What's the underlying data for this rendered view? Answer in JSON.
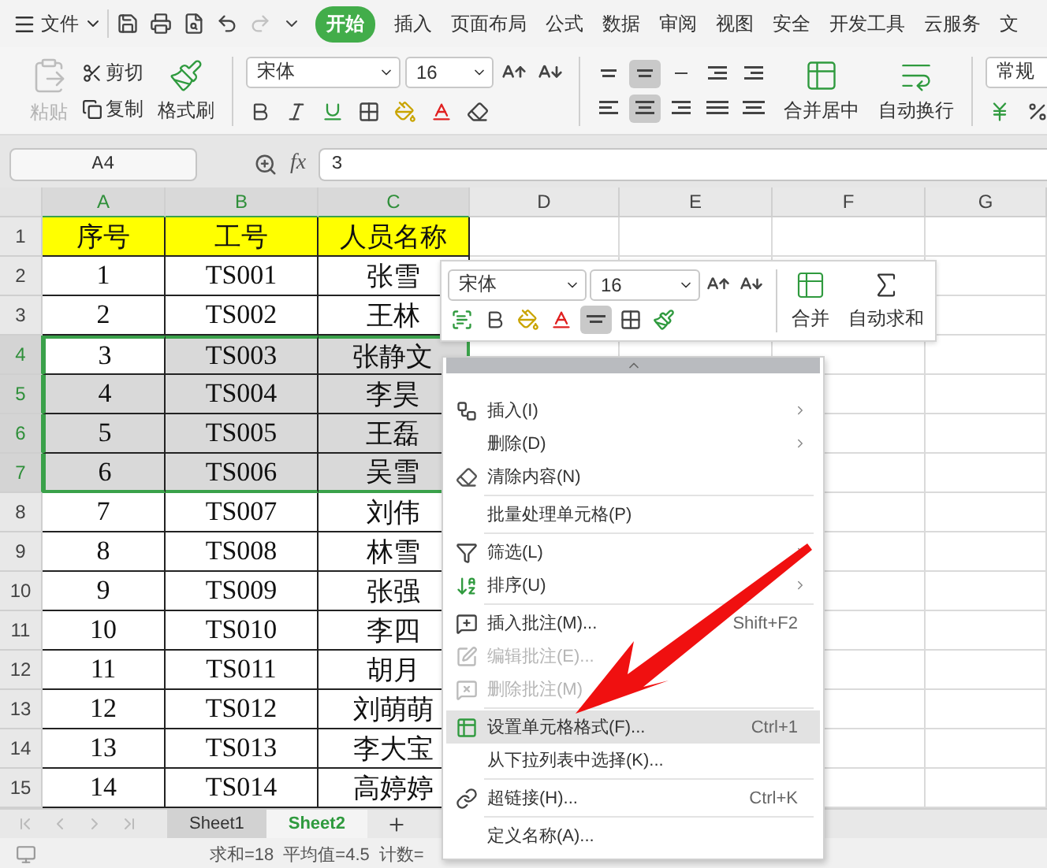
{
  "menu_bar": {
    "file_menu": "文件",
    "redo": {
      "disabled": true
    },
    "tabs": [
      {
        "label": "开始",
        "selected": true
      },
      {
        "label": "插入",
        "selected": false
      },
      {
        "label": "页面布局",
        "selected": false
      },
      {
        "label": "公式",
        "selected": false
      },
      {
        "label": "数据",
        "selected": false
      },
      {
        "label": "审阅",
        "selected": false
      },
      {
        "label": "视图",
        "selected": false
      },
      {
        "label": "安全",
        "selected": false
      },
      {
        "label": "开发工具",
        "selected": false
      },
      {
        "label": "云服务",
        "selected": false
      },
      {
        "label": "文",
        "selected": false
      }
    ]
  },
  "ribbon": {
    "paste": {
      "label": "粘贴",
      "disabled": true
    },
    "cut": "剪切",
    "copy": "复制",
    "format_painter": "格式刷",
    "font_name": "宋体",
    "font_size": "16",
    "vertical_align": [
      {
        "selected": false
      },
      {
        "selected": true
      },
      {
        "selected": false
      }
    ],
    "horizontal_align": [
      {
        "selected": false
      },
      {
        "selected": true
      },
      {
        "selected": false
      }
    ],
    "merge_center": "合并居中",
    "wrap_text": "自动换行",
    "number_format": "常规"
  },
  "formula_bar": {
    "name_box": "A4",
    "function_label": "fx",
    "value": "3"
  },
  "sheet": {
    "columns": [
      {
        "label": "A",
        "selected": true
      },
      {
        "label": "B",
        "selected": true
      },
      {
        "label": "C",
        "selected": true
      },
      {
        "label": "D",
        "selected": false
      },
      {
        "label": "E",
        "selected": false
      },
      {
        "label": "F",
        "selected": false
      },
      {
        "label": "G",
        "selected": false
      }
    ],
    "rows": [
      {
        "number": "1",
        "kind": "header",
        "selected": false,
        "active": false,
        "cells": [
          "序号",
          "工号",
          "人员名称"
        ]
      },
      {
        "number": "2",
        "kind": "data",
        "selected": false,
        "active": false,
        "cells": [
          "1",
          "TS001",
          "张雪"
        ]
      },
      {
        "number": "3",
        "kind": "data",
        "selected": false,
        "active": false,
        "cells": [
          "2",
          "TS002",
          "王林"
        ]
      },
      {
        "number": "4",
        "kind": "data",
        "selected": true,
        "active": true,
        "cells": [
          "3",
          "TS003",
          "张静文"
        ]
      },
      {
        "number": "5",
        "kind": "data",
        "selected": true,
        "active": false,
        "cells": [
          "4",
          "TS004",
          "李昊"
        ]
      },
      {
        "number": "6",
        "kind": "data",
        "selected": true,
        "active": false,
        "cells": [
          "5",
          "TS005",
          "王磊"
        ]
      },
      {
        "number": "7",
        "kind": "data",
        "selected": true,
        "active": false,
        "cells": [
          "6",
          "TS006",
          "吴雪"
        ]
      },
      {
        "number": "8",
        "kind": "data",
        "selected": false,
        "active": false,
        "cells": [
          "7",
          "TS007",
          "刘伟"
        ]
      },
      {
        "number": "9",
        "kind": "data",
        "selected": false,
        "active": false,
        "cells": [
          "8",
          "TS008",
          "林雪"
        ]
      },
      {
        "number": "10",
        "kind": "data",
        "selected": false,
        "active": false,
        "cells": [
          "9",
          "TS009",
          "张强"
        ]
      },
      {
        "number": "11",
        "kind": "data",
        "selected": false,
        "active": false,
        "cells": [
          "10",
          "TS010",
          "李四"
        ]
      },
      {
        "number": "12",
        "kind": "data",
        "selected": false,
        "active": false,
        "cells": [
          "11",
          "TS011",
          "胡月"
        ]
      },
      {
        "number": "13",
        "kind": "data",
        "selected": false,
        "active": false,
        "cells": [
          "12",
          "TS012",
          "刘萌萌"
        ]
      },
      {
        "number": "14",
        "kind": "data",
        "selected": false,
        "active": false,
        "cells": [
          "13",
          "TS013",
          "李大宝"
        ]
      },
      {
        "number": "15",
        "kind": "data",
        "selected": false,
        "active": false,
        "cells": [
          "14",
          "TS014",
          "高婷婷"
        ]
      }
    ]
  },
  "sheet_tabs": [
    {
      "label": "Sheet1",
      "selected": false
    },
    {
      "label": "Sheet2",
      "selected": true
    }
  ],
  "status_bar": {
    "sum": "求和=18",
    "average": "平均值=4.5",
    "count": "计数="
  },
  "mini_toolbar": {
    "font_name": "宋体",
    "font_size": "16",
    "align_selected": true,
    "merge": "合并",
    "autosum": "自动求和"
  },
  "context_menu": {
    "items": [
      {
        "kind": "item",
        "label": "插入(I)",
        "submenu": true,
        "disabled": false,
        "selected": false
      },
      {
        "kind": "item",
        "label": "删除(D)",
        "submenu": true,
        "disabled": false,
        "selected": false
      },
      {
        "kind": "item",
        "label": "清除内容(N)",
        "submenu": false,
        "disabled": false,
        "selected": false
      },
      {
        "kind": "separator"
      },
      {
        "kind": "item",
        "label": "批量处理单元格(P)",
        "submenu": false,
        "disabled": false,
        "selected": false
      },
      {
        "kind": "separator"
      },
      {
        "kind": "item",
        "label": "筛选(L)",
        "submenu": true,
        "disabled": false,
        "selected": false
      },
      {
        "kind": "item",
        "label": "排序(U)",
        "submenu": true,
        "disabled": false,
        "selected": false
      },
      {
        "kind": "separator"
      },
      {
        "kind": "item",
        "label": "插入批注(M)...",
        "shortcut": "Shift+F2",
        "submenu": false,
        "disabled": false,
        "selected": false
      },
      {
        "kind": "item",
        "label": "编辑批注(E)...",
        "submenu": false,
        "disabled": true,
        "selected": false
      },
      {
        "kind": "item",
        "label": "删除批注(M)",
        "submenu": false,
        "disabled": true,
        "selected": false
      },
      {
        "kind": "separator"
      },
      {
        "kind": "item",
        "label": "设置单元格格式(F)...",
        "shortcut": "Ctrl+1",
        "submenu": false,
        "disabled": false,
        "selected": true
      },
      {
        "kind": "item",
        "label": "从下拉列表中选择(K)...",
        "submenu": false,
        "disabled": false,
        "selected": false
      },
      {
        "kind": "separator"
      },
      {
        "kind": "item",
        "label": "超链接(H)...",
        "shortcut": "Ctrl+K",
        "submenu": false,
        "disabled": false,
        "selected": false
      },
      {
        "kind": "separator"
      },
      {
        "kind": "item",
        "label": "定义名称(A)...",
        "submenu": false,
        "disabled": false,
        "selected": false
      }
    ]
  }
}
